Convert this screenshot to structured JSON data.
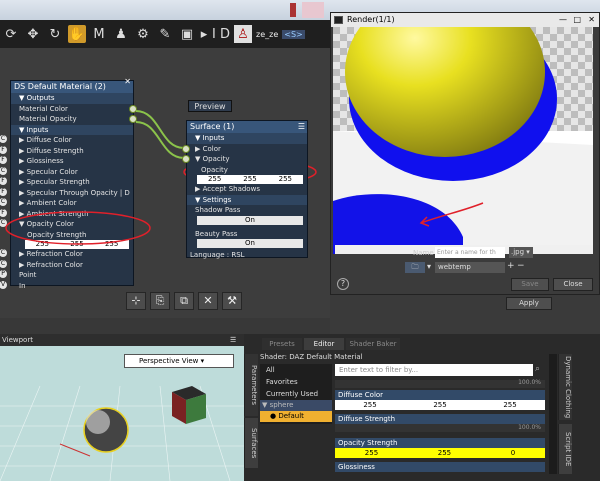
{
  "toolbar": {
    "user_label": "ze_ze",
    "tag": "<S>",
    "icons": [
      "reload-icon",
      "move-icon",
      "rotate-icon",
      "hand-icon",
      "morph-icon",
      "figure-icon",
      "node-icon",
      "pose-icon",
      "camera-icon",
      "id-icon",
      "person-icon"
    ]
  },
  "shader_editor": {
    "preview_tab": "Preview",
    "material_node": {
      "title": "DS Default Material (2)",
      "outputs_label": "Outputs",
      "output_items": [
        "Material Color",
        "Material Opacity"
      ],
      "inputs_label": "Inputs",
      "inputs": [
        {
          "pin": "C",
          "label": "Diffuse Color"
        },
        {
          "pin": "F",
          "label": "Diffuse Strength"
        },
        {
          "pin": "F",
          "label": "Glossiness"
        },
        {
          "pin": "C",
          "label": "Specular Color"
        },
        {
          "pin": "F",
          "label": "Specular Strength"
        },
        {
          "pin": "F",
          "label": "Specular Through Opacity | D"
        },
        {
          "pin": "C",
          "label": "Ambient Color"
        },
        {
          "pin": "F",
          "label": "Ambient Strength"
        },
        {
          "pin": "C",
          "label": "Opacity Color"
        }
      ],
      "opacity_strength_label": "Opacity Strength",
      "opacity_values": [
        "255",
        "255",
        "255"
      ],
      "lower_inputs": [
        {
          "pin": "C",
          "label": "Refraction Color"
        },
        {
          "pin": "C",
          "label": "Refraction Color"
        },
        {
          "pin": "P",
          "label": "Point"
        },
        {
          "pin": "V",
          "label": "In"
        }
      ]
    },
    "surface_node": {
      "title": "Surface (1)",
      "inputs_label": "Inputs",
      "color_label": "Color",
      "opacity_label": "Opacity",
      "opacity_sub": "Opacity",
      "opacity_values": [
        "255",
        "255",
        "255"
      ],
      "accept_shadows": "Accept Shadows",
      "settings_label": "Settings",
      "shadow_pass_label": "Shadow Pass",
      "shadow_pass_value": "On",
      "beauty_pass_label": "Beauty Pass",
      "beauty_pass_value": "On",
      "language": "Language : RSL"
    },
    "bottom_buttons": [
      "⊹",
      "⎘",
      "⧉",
      "✕",
      "⚒"
    ],
    "apply_label": "Apply"
  },
  "render_window": {
    "title": "Render(1/1)",
    "name_label": "Name :",
    "name_placeholder": "Enter a name for th",
    "format": ".jpg",
    "folder": "webtemp",
    "save_label": "Save",
    "close_label": "Close",
    "help_label": "?"
  },
  "viewport": {
    "tab_label": "Viewport",
    "view_select": "Perspective View"
  },
  "surfaces_pane": {
    "tabs": [
      "Presets",
      "Editor",
      "Shader Baker"
    ],
    "active_tab": "Editor",
    "shader_line": "Shader: DAZ Default Material",
    "filter_placeholder": "Enter text to filter by...",
    "groups": [
      "All",
      "Favorites",
      "Currently Used"
    ],
    "tree_root": "sphere",
    "tree_child": "Default",
    "slider_pct": "100.0%",
    "props": [
      {
        "label": "Diffuse Color",
        "values": [
          "255",
          "255",
          "255"
        ]
      },
      {
        "label": "Diffuse Strength",
        "values": [
          "100.0%"
        ]
      },
      {
        "label": "Opacity Strength",
        "values": [
          "255",
          "255",
          "0"
        ]
      },
      {
        "label": "Glossiness",
        "values": []
      }
    ],
    "side_tabs_left": [
      "Parameters",
      "Surfaces"
    ],
    "side_tabs_right": [
      "Dynamic Clothing",
      "Script IDE"
    ]
  },
  "colors": {
    "accent_yellow": "#ffff00",
    "node_blue": "#38567a",
    "annotation_red": "#e0202a"
  }
}
